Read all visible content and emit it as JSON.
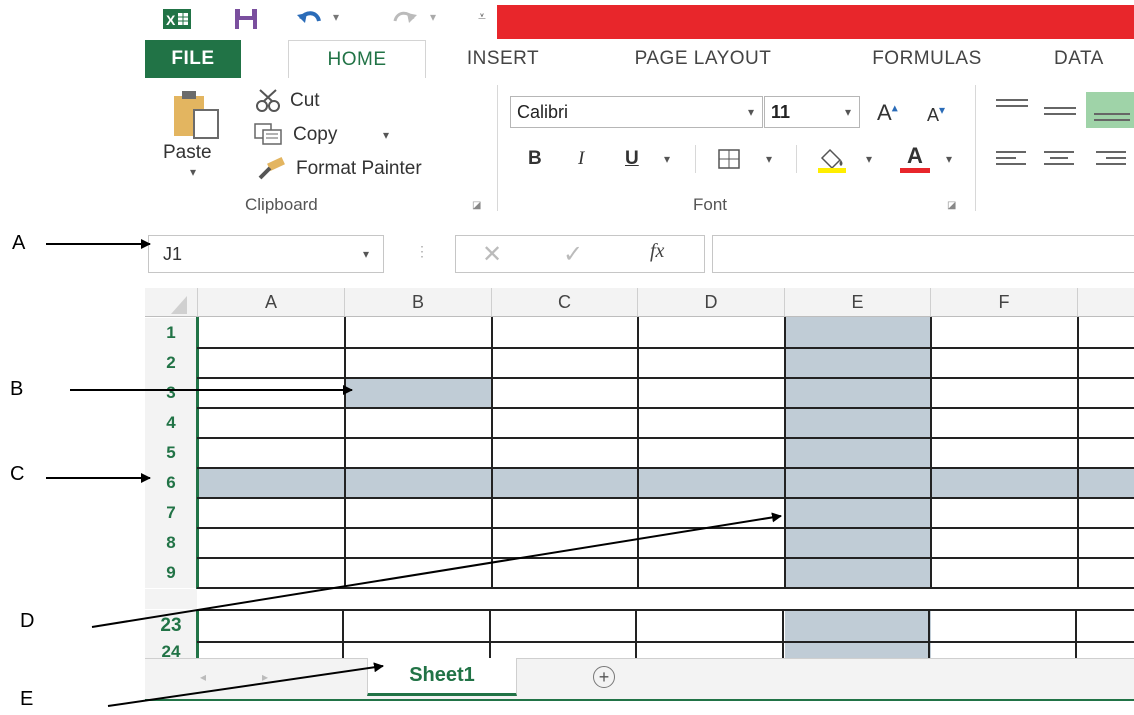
{
  "quick_access": {
    "icons": [
      "excel-icon",
      "save-icon",
      "undo-icon",
      "redo-icon",
      "customize-icon"
    ]
  },
  "tabs": [
    "FILE",
    "HOME",
    "INSERT",
    "PAGE LAYOUT",
    "FORMULAS",
    "DATA"
  ],
  "ribbon": {
    "clipboard": {
      "paste_label": "Paste",
      "cut_label": "Cut",
      "copy_label": "Copy",
      "format_painter_label": "Format Painter",
      "group_label": "Clipboard"
    },
    "font": {
      "font_name": "Calibri",
      "font_size": "11",
      "bold": "B",
      "italic": "I",
      "underline": "U",
      "font_color_glyph": "A",
      "grow_glyph": "A",
      "shrink_glyph": "A",
      "group_label": "Font"
    }
  },
  "formula_bar": {
    "name_box": "J1",
    "fx_glyph": "fx",
    "formula_value": ""
  },
  "grid": {
    "columns": [
      "A",
      "B",
      "C",
      "D",
      "E",
      "F"
    ],
    "rows": [
      "1",
      "2",
      "3",
      "4",
      "5",
      "6",
      "7",
      "8",
      "9"
    ],
    "rows_after_break": [
      "23",
      "24"
    ],
    "highlight_color": "#c0ccd6"
  },
  "sheet_tabs": {
    "active": "Sheet1",
    "add_glyph": "+"
  },
  "annotations": [
    "A",
    "B",
    "C",
    "D",
    "E"
  ],
  "colors": {
    "excel_green": "#217346",
    "title_red": "#e8262b"
  }
}
